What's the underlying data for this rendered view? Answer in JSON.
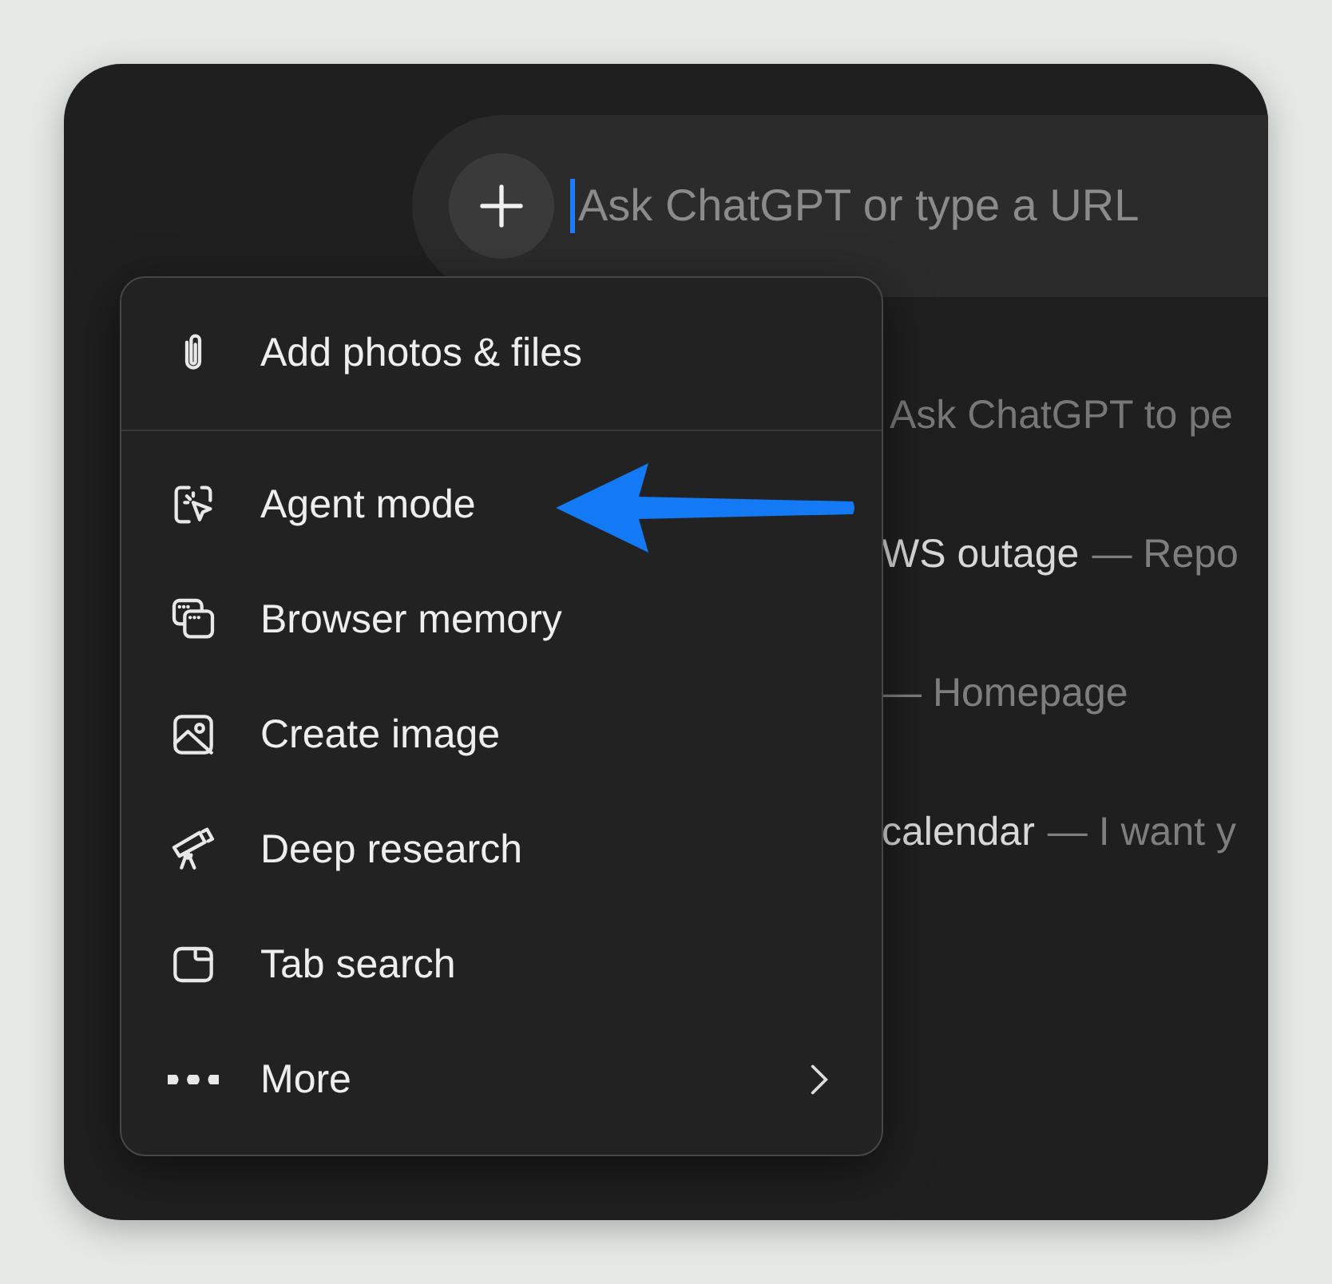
{
  "search": {
    "placeholder": "Ask ChatGPT or type a URL",
    "focused": true
  },
  "hint": "Ask ChatGPT to pe",
  "suggestions": [
    {
      "title": "WS outage",
      "detail": "— Repo"
    },
    {
      "detail": "— Homepage"
    },
    {
      "title": "calendar",
      "detail": "— I want y"
    }
  ],
  "menu": {
    "sections": [
      [
        {
          "label": "Add photos & files",
          "submenu": false
        }
      ],
      [
        {
          "label": "Agent mode",
          "submenu": false
        },
        {
          "label": "Browser memory",
          "submenu": false
        },
        {
          "label": "Create image",
          "submenu": false
        },
        {
          "label": "Deep research",
          "submenu": false
        },
        {
          "label": "Tab search",
          "submenu": false
        },
        {
          "label": "More",
          "submenu": true
        }
      ]
    ]
  }
}
